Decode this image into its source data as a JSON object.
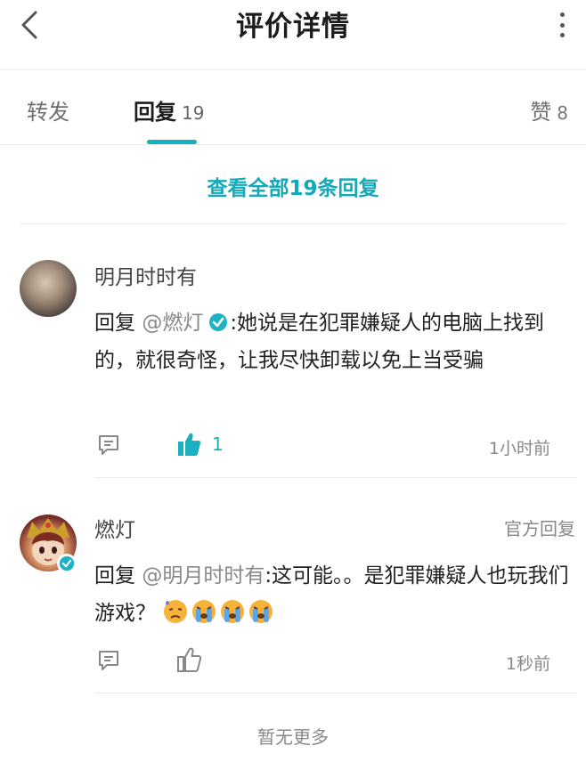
{
  "header": {
    "title": "评价详情"
  },
  "tabs": {
    "forward": {
      "label": "转发"
    },
    "reply": {
      "label": "回复",
      "count": "19"
    },
    "like": {
      "label": "赞",
      "count": "8"
    }
  },
  "view_all_label": "查看全部19条回复",
  "comments": [
    {
      "username": "明月时时有",
      "reply_prefix": "回复",
      "mention": "@燃灯",
      "text": ":她说是在犯罪嫌疑人的电脑上找到的，就很奇怪，让我尽快卸载以免上当受骗",
      "like_count": "1",
      "time": "1小时前",
      "liked": true
    },
    {
      "username": "燃灯",
      "official_tag": "官方回复",
      "reply_prefix": "回复",
      "mention": "@明月时时有",
      "text": ":这可能。。是犯罪嫌疑人也玩我们游戏？",
      "emojis": [
        "sad-sweat-emoji",
        "crying-emoji",
        "crying-emoji",
        "crying-emoji"
      ],
      "time": "1秒前",
      "liked": false
    }
  ],
  "footer": {
    "no_more": "暂无更多"
  },
  "colors": {
    "accent": "#14b1c1",
    "verified": "#1db3c5"
  }
}
